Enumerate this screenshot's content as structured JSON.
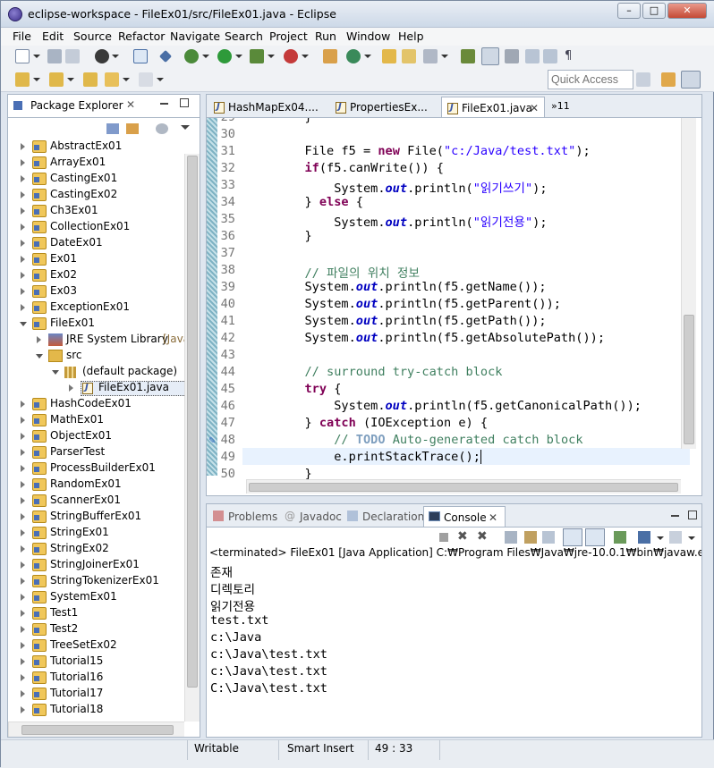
{
  "window": {
    "title": "eclipse-workspace - FileEx01/src/FileEx01.java - Eclipse",
    "minimize": "–",
    "maximize": "□",
    "close": "✕"
  },
  "menu": [
    "File",
    "Edit",
    "Source",
    "Refactor",
    "Navigate",
    "Search",
    "Project",
    "Run",
    "Window",
    "Help"
  ],
  "quick_access": {
    "placeholder": "Quick Access"
  },
  "package_explorer": {
    "title": "Package Explorer",
    "items": [
      {
        "label": "AbstractEx01"
      },
      {
        "label": "ArrayEx01"
      },
      {
        "label": "CastingEx01"
      },
      {
        "label": "CastingEx02"
      },
      {
        "label": "Ch3Ex01"
      },
      {
        "label": "CollectionEx01"
      },
      {
        "label": "DateEx01"
      },
      {
        "label": "Ex01"
      },
      {
        "label": "Ex02"
      },
      {
        "label": "Ex03"
      },
      {
        "label": "ExceptionEx01"
      },
      {
        "label": "FileEx01"
      },
      {
        "label": "JRE System Library",
        "extra": "[Java"
      },
      {
        "label": "src"
      },
      {
        "label": "(default package)"
      },
      {
        "label": "FileEx01.java"
      },
      {
        "label": "HashCodeEx01"
      },
      {
        "label": "MathEx01"
      },
      {
        "label": "ObjectEx01"
      },
      {
        "label": "ParserTest"
      },
      {
        "label": "ProcessBuilderEx01"
      },
      {
        "label": "RandomEx01"
      },
      {
        "label": "ScannerEx01"
      },
      {
        "label": "StringBufferEx01"
      },
      {
        "label": "StringEx01"
      },
      {
        "label": "StringEx02"
      },
      {
        "label": "StringJoinerEx01"
      },
      {
        "label": "StringTokenizerEx01"
      },
      {
        "label": "SystemEx01"
      },
      {
        "label": "Test1"
      },
      {
        "label": "Test2"
      },
      {
        "label": "TreeSetEx02"
      },
      {
        "label": "Tutorial15"
      },
      {
        "label": "Tutorial16"
      },
      {
        "label": "Tutorial17"
      },
      {
        "label": "Tutorial18"
      }
    ]
  },
  "editor": {
    "tabs": [
      {
        "label": "HashMapEx04...."
      },
      {
        "label": "PropertiesEx..."
      },
      {
        "label": "FileEx01.java"
      }
    ],
    "overflow": "»11",
    "lines": [
      "29",
      "30",
      "31",
      "32",
      "33",
      "34",
      "35",
      "36",
      "37",
      "38",
      "39",
      "40",
      "41",
      "42",
      "43",
      "44",
      "45",
      "46",
      "47",
      "48",
      "49",
      "50"
    ]
  },
  "console": {
    "tabs": [
      {
        "label": "Problems"
      },
      {
        "label": "Javadoc"
      },
      {
        "label": "Declaration"
      },
      {
        "label": "Console"
      }
    ],
    "header": "<terminated> FileEx01 [Java Application] C:₩Program Files₩Java₩jre-10.0.1₩bin₩javaw.exe (2018. 6. 2",
    "output": [
      "존재",
      "디렉토리",
      "읽기전용",
      "test.txt",
      "c:\\Java",
      "c:\\Java\\test.txt",
      "c:\\Java\\test.txt",
      "C:\\Java\\test.txt"
    ]
  },
  "status": {
    "writable": "Writable",
    "insert_mode": "Smart Insert",
    "position": "49 : 33"
  },
  "colors": {
    "keyword": "#7f0055",
    "string": "#2a00ff",
    "field": "#0000c0",
    "comment": "#3f7f5f"
  }
}
